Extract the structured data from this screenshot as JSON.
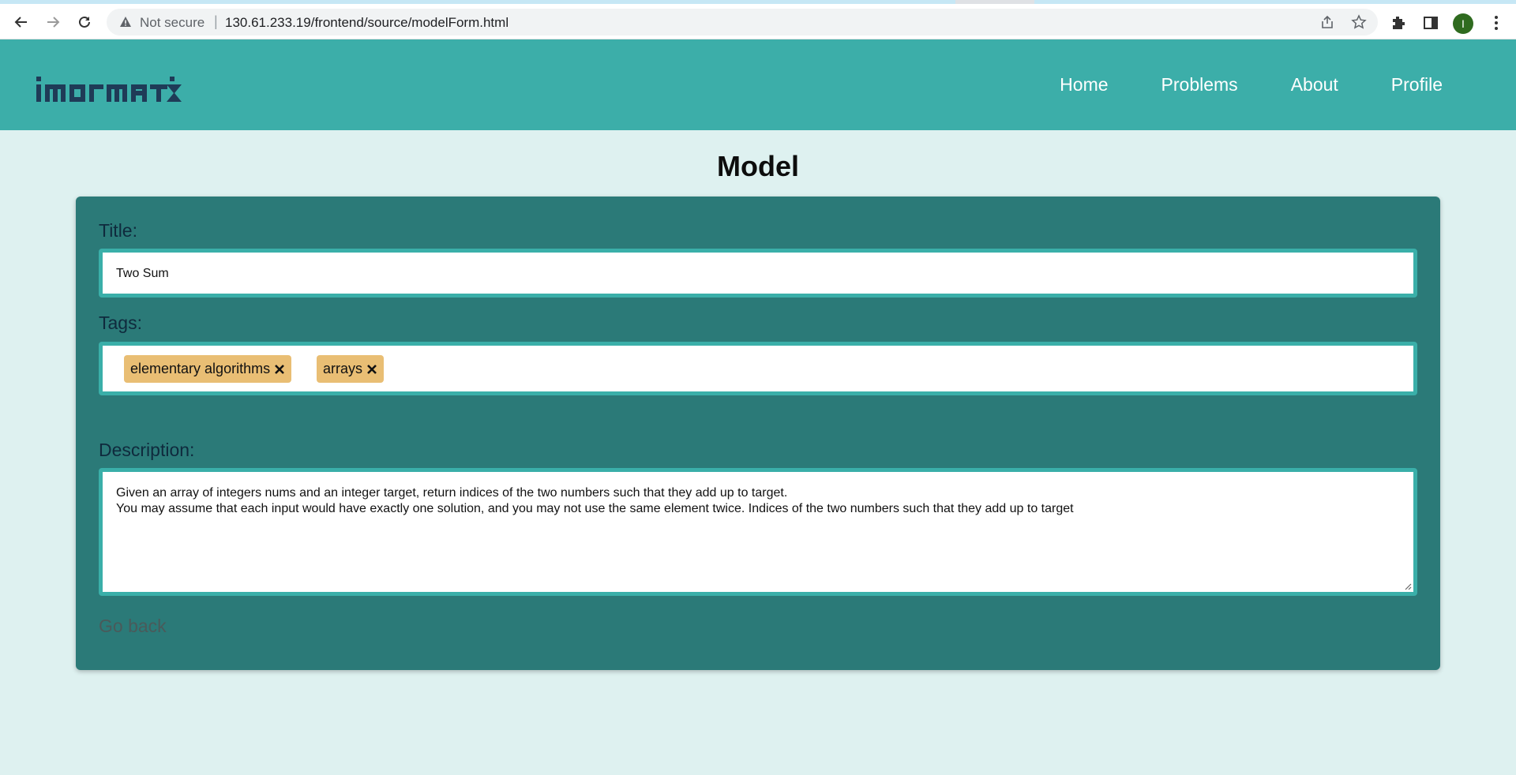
{
  "browser": {
    "security_label": "Not secure",
    "separator": "|",
    "url": "130.61.233.19/frontend/source/modelForm.html",
    "profile_initial": "I"
  },
  "header": {
    "logo_text": "imormatix",
    "nav": [
      {
        "label": "Home"
      },
      {
        "label": "Problems"
      },
      {
        "label": "About"
      },
      {
        "label": "Profile"
      }
    ],
    "brand_color": "#3caea9"
  },
  "page": {
    "title": "Model"
  },
  "form": {
    "title_label": "Title:",
    "title_value": "Two Sum",
    "tags_label": "Tags:",
    "tags": [
      {
        "label": "elementary algorithms"
      },
      {
        "label": "arrays"
      }
    ],
    "description_label": "Description:",
    "description_lines": [
      "Given an array of integers nums and an integer target, return indices of the two numbers such that they add up to target.",
      "You may assume that each input would have exactly one solution, and you may not use the same element twice. Indices of the two numbers such that they add up to target"
    ],
    "go_back_label": "Go back",
    "card_color": "#2b7a78",
    "tag_color": "#e9be74"
  }
}
